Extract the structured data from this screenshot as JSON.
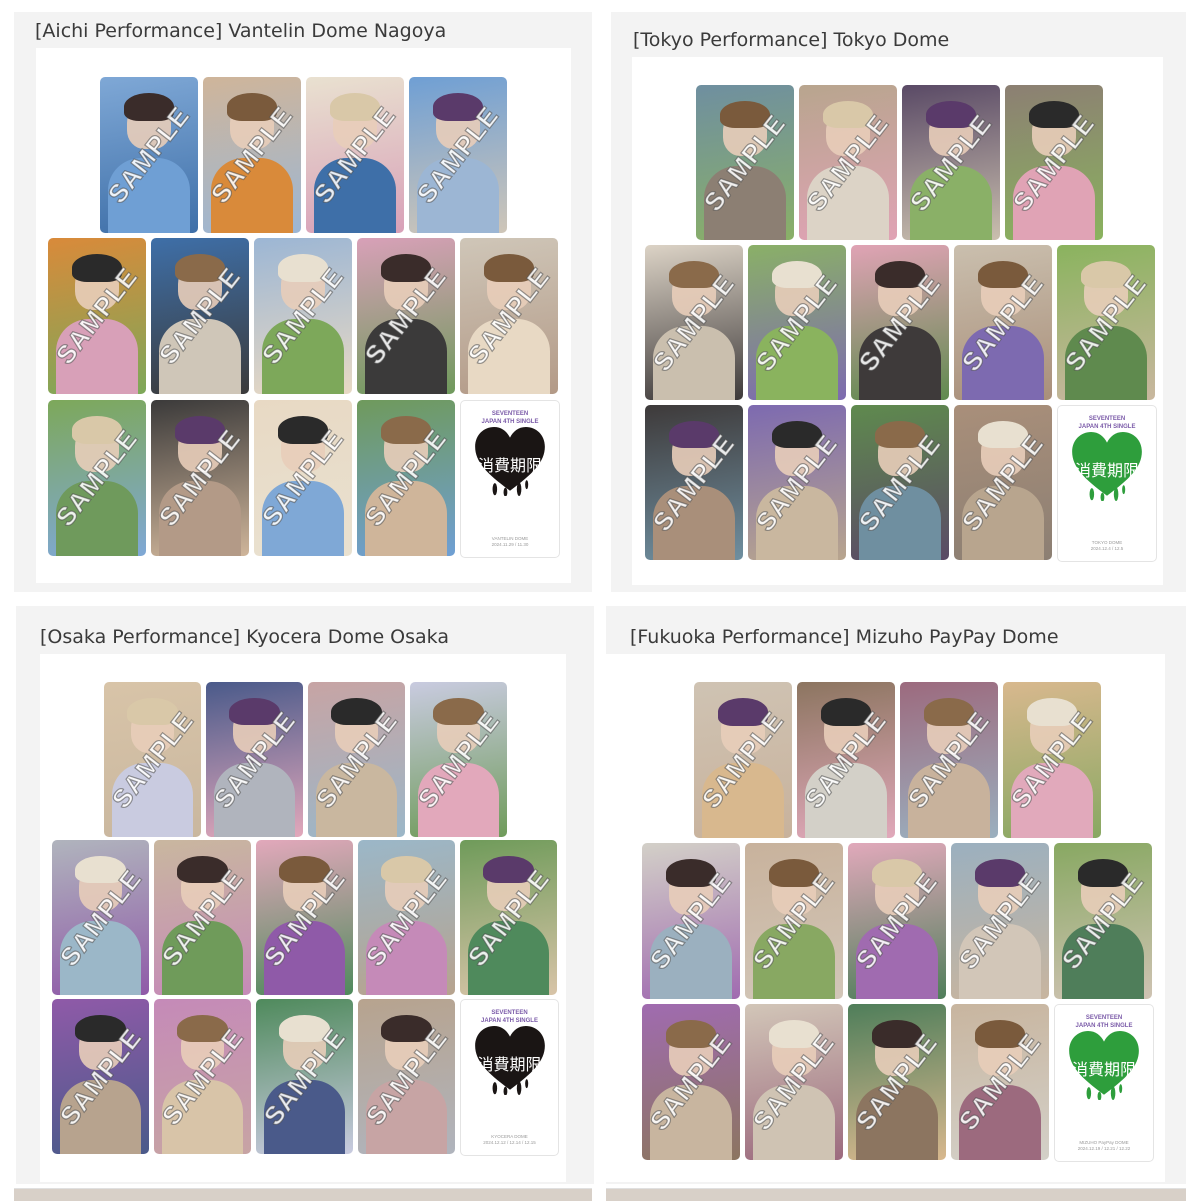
{
  "watermark_text": "SAMPLE",
  "panels": [
    {
      "title": "[Aichi Performance] Vantelin Dome Nagoya",
      "special_card": {
        "line1": "SEVENTEEN",
        "line2": "JAPAN 4TH SINGLE",
        "jp_title": "消費期限",
        "heart_color": "#1a1514",
        "venue": "VANTELIN DOME",
        "date": "2024.11.29 / 11.30"
      }
    },
    {
      "title": "[Tokyo Performance] Tokyo Dome",
      "special_card": {
        "line1": "SEVENTEEN",
        "line2": "JAPAN 4TH SINGLE",
        "jp_title": "消費期限",
        "heart_color": "#2e9e3c",
        "venue": "TOKYO DOME",
        "date": "2024.12.4 / 12.5"
      }
    },
    {
      "title": "[Osaka Performance] Kyocera Dome Osaka",
      "special_card": {
        "line1": "SEVENTEEN",
        "line2": "JAPAN 4TH SINGLE",
        "jp_title": "消費期限",
        "heart_color": "#1a1514",
        "venue": "KYOCERA DOME",
        "date": "2024.12.12 / 12.14 / 12.15"
      }
    },
    {
      "title": "[Fukuoka Performance] Mizuho PayPay Dome",
      "special_card": {
        "line1": "SEVENTEEN",
        "line2": "JAPAN 4TH SINGLE",
        "jp_title": "消費期限",
        "heart_color": "#2e9e3c",
        "venue": "MIZUHO PayPay DOME",
        "date": "2024.12.19 / 12.21 / 12.22"
      }
    }
  ]
}
